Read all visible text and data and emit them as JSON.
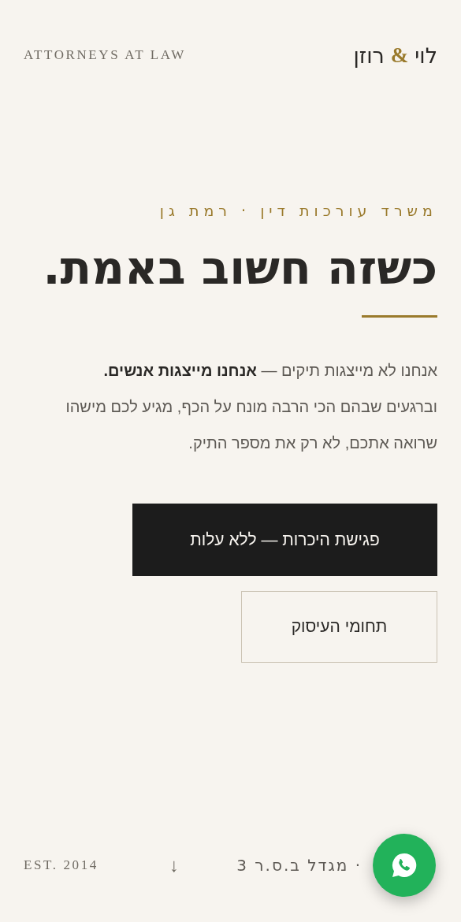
{
  "header": {
    "tagline": "ATTORNEYS AT LAW",
    "logo": {
      "first": "לוי",
      "ampersand": "&",
      "second": "רוזן"
    }
  },
  "hero": {
    "eyebrow": "משרד עורכות דין · רמת גן",
    "headline": "כשזה חשוב באמת.",
    "paragraph": "אנחנו לא מייצגות תיקים — **אנחנו מייצגות אנשים.** וברגעים שבהם הכי הרבה מונח על הכף, מגיע לכם מישהו שרואה אתכם, לא רק את מספר התיק.",
    "buttons": [
      {
        "kind": "primary",
        "label": "פגישת היכרות — ללא עלות"
      },
      {
        "kind": "outline",
        "label": "תחומי העיסוק"
      }
    ]
  },
  "footer": {
    "established": "EST. 2014",
    "scroll_arrow": "↓",
    "address": "· מגדל ב.ס.ר 3"
  }
}
